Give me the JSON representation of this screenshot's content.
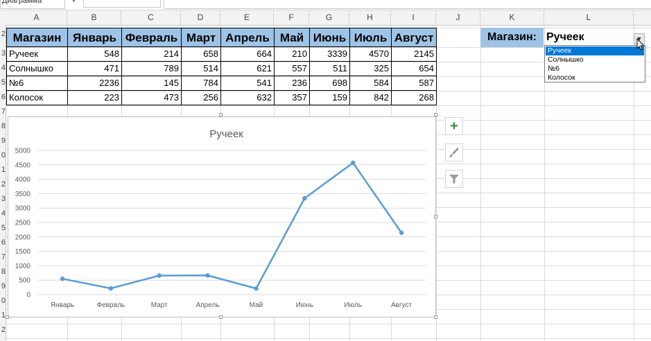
{
  "namebox": {
    "value": "Диаграмма"
  },
  "columns": [
    "A",
    "B",
    "C",
    "D",
    "E",
    "F",
    "G",
    "H",
    "I",
    "J",
    "K",
    "L"
  ],
  "row_numbers": [
    "1",
    "2",
    "3",
    "4",
    "5",
    "6",
    "7",
    "8",
    "9",
    "0",
    "1",
    "2",
    "3",
    "4",
    "5",
    "6",
    "7",
    "8",
    "9",
    "0",
    "1",
    "2"
  ],
  "table": {
    "headers": [
      "Магазин",
      "Январь",
      "Февраль",
      "Март",
      "Апрель",
      "Май",
      "Июнь",
      "Июль",
      "Август"
    ],
    "rows": [
      [
        "Ручеек",
        "548",
        "214",
        "658",
        "664",
        "210",
        "3339",
        "4570",
        "2145"
      ],
      [
        "Солнышко",
        "471",
        "789",
        "514",
        "621",
        "557",
        "511",
        "325",
        "654"
      ],
      [
        "№6",
        "2236",
        "145",
        "784",
        "541",
        "236",
        "698",
        "584",
        "587"
      ],
      [
        "Колосок",
        "223",
        "473",
        "256",
        "632",
        "357",
        "159",
        "842",
        "268"
      ]
    ]
  },
  "selector": {
    "label": "Магазин:",
    "value": "Ручеек",
    "options": [
      "Ручеек",
      "Солнышко",
      "№6",
      "Колосок"
    ]
  },
  "side_buttons": {
    "add": "+",
    "style": "🖌",
    "filter": "⏷"
  },
  "colors": {
    "header_fill": "#9dc3e6",
    "series": "#5b9bd5",
    "selection": "#0078d7"
  },
  "chart_data": {
    "type": "line",
    "title": "Ручеек",
    "categories": [
      "Январь",
      "Февраль",
      "Март",
      "Апрель",
      "Май",
      "Июнь",
      "Июль",
      "Август"
    ],
    "values": [
      548,
      214,
      658,
      664,
      210,
      3339,
      4570,
      2145
    ],
    "yticks": [
      "0",
      "500",
      "1000",
      "1500",
      "2000",
      "2500",
      "3000",
      "3500",
      "4000",
      "4500",
      "5000"
    ],
    "ylim": [
      0,
      5000
    ],
    "grid": true,
    "legend": "none"
  }
}
